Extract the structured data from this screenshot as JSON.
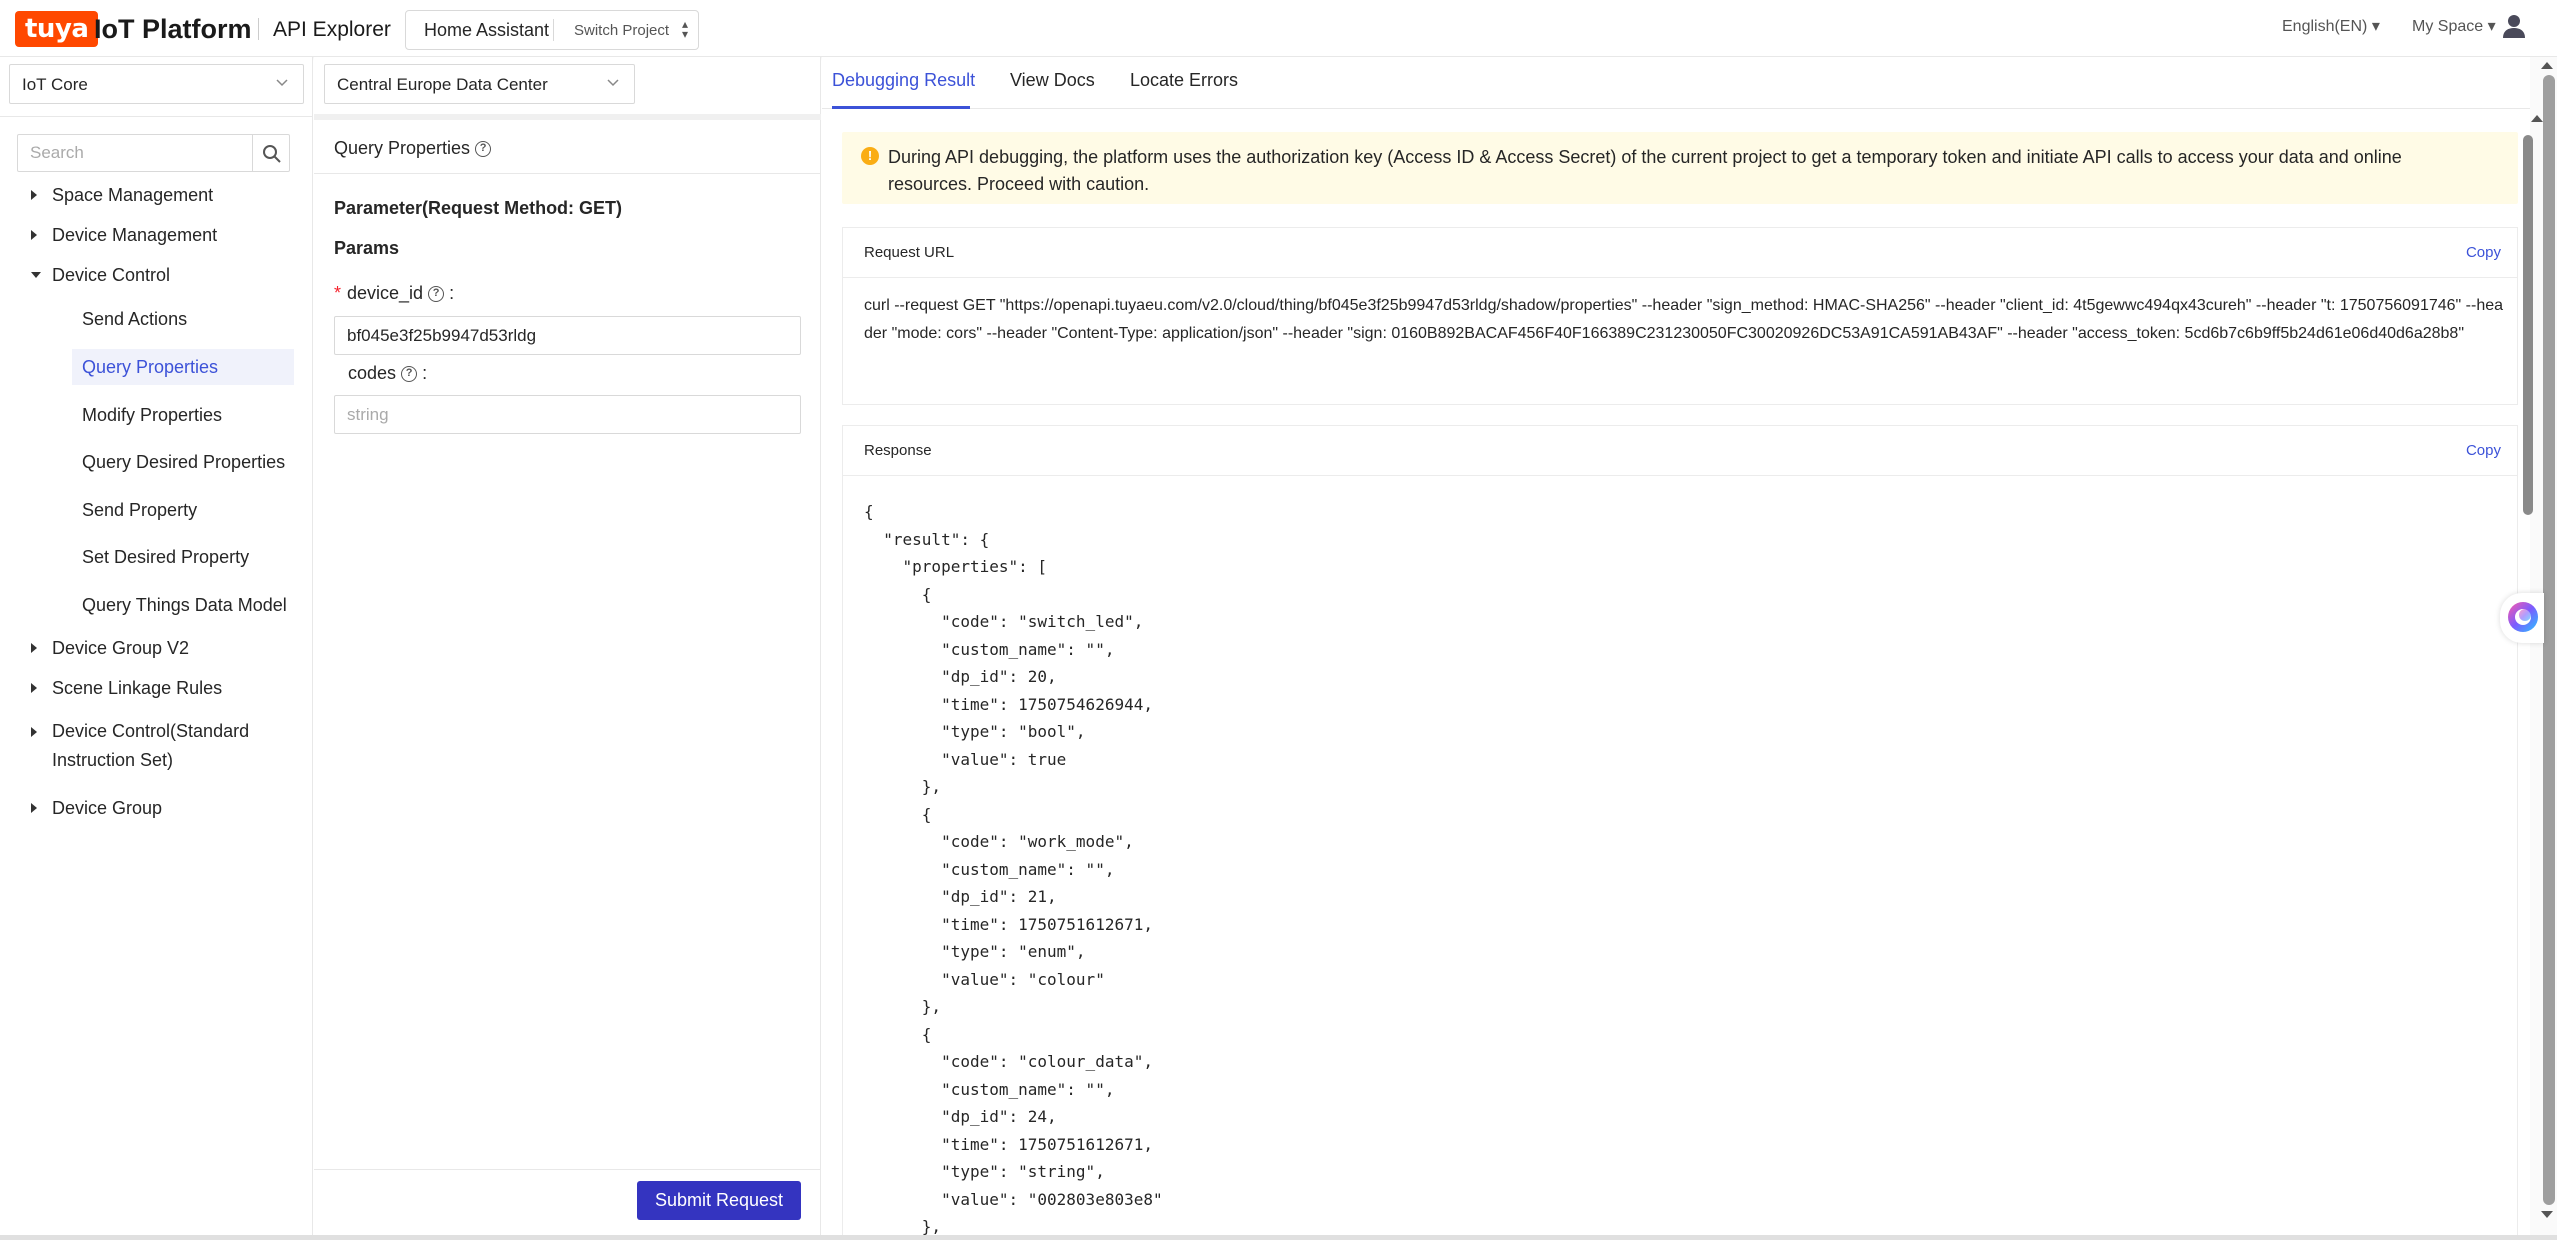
{
  "header": {
    "logo": "tuya",
    "platform": "IoT Platform",
    "app": "API Explorer",
    "project_name": "Home Assistant",
    "project_type": "Switch Project",
    "language": "English(EN)",
    "space": "My Space"
  },
  "sidebar": {
    "category": "IoT Core",
    "search_placeholder": "Search",
    "groups": [
      {
        "label": "Space Management"
      },
      {
        "label": "Device Management"
      },
      {
        "label": "Device Control"
      },
      {
        "label": "Device Group V2"
      },
      {
        "label": "Scene Linkage Rules"
      },
      {
        "label": "Device Control(Standard"
      },
      {
        "label": "Instruction Set)"
      },
      {
        "label": "Device Group"
      }
    ],
    "children": [
      {
        "label": "Send Actions"
      },
      {
        "label": "Query Properties"
      },
      {
        "label": "Modify Properties"
      },
      {
        "label": "Query Desired Properties"
      },
      {
        "label": "Send Property"
      },
      {
        "label": "Set Desired Property"
      },
      {
        "label": "Query Things Data Model"
      }
    ]
  },
  "middle": {
    "data_center": "Central Europe Data Center",
    "title": "Query Properties",
    "parameter_label": "Parameter(Request Method: GET)",
    "params_heading": "Params",
    "device_id_label": "device_id",
    "device_id_value": "bf045e3f25b9947d53rldg",
    "codes_label": "codes",
    "codes_placeholder": "string",
    "submit": "Submit Request"
  },
  "right": {
    "tabs": [
      "Debugging Result",
      "View Docs",
      "Locate Errors"
    ],
    "notice": "During API debugging, the platform uses the authorization key (Access ID & Access Secret) of the current project to get a temporary token and initiate API calls to access your data and online resources. Proceed with caution.",
    "request_url_title": "Request URL",
    "copy": "Copy",
    "request_url": "curl --request GET \"https://openapi.tuyaeu.com/v2.0/cloud/thing/bf045e3f25b9947d53rldg/shadow/properties\" --header \"sign_method: HMAC-SHA256\" --header \"client_id: 4t5gewwc494qx43cureh\" --header \"t: 1750756091746\" --header \"mode: cors\" --header \"Content-Type: application/json\" --header \"sign: 0160B892BACAF456F40F166389C231230050FC30020926DC53A91CA591AB43AF\" --header \"access_token: 5cd6b7c6b9ff5b24d61e06d40d6a28b8\"",
    "response_title": "Response",
    "response_lines": [
      "{",
      "  \"result\": {",
      "    \"properties\": [",
      "      {",
      "        \"code\": \"switch_led\",",
      "        \"custom_name\": \"\",",
      "        \"dp_id\": 20,",
      "        \"time\": 1750754626944,",
      "        \"type\": \"bool\",",
      "        \"value\": true",
      "      },",
      "      {",
      "        \"code\": \"work_mode\",",
      "        \"custom_name\": \"\",",
      "        \"dp_id\": 21,",
      "        \"time\": 1750751612671,",
      "        \"type\": \"enum\",",
      "        \"value\": \"colour\"",
      "      },",
      "      {",
      "        \"code\": \"colour_data\",",
      "        \"custom_name\": \"\",",
      "        \"dp_id\": 24,",
      "        \"time\": 1750751612671,",
      "        \"type\": \"string\",",
      "        \"value\": \"002803e803e8\"",
      "      },"
    ]
  },
  "colors": {
    "brand": "#ff4800",
    "accent": "#3c52d8",
    "primary_button": "#3434c0",
    "notice_bg": "#fffbe6",
    "warning": "#faad14"
  }
}
